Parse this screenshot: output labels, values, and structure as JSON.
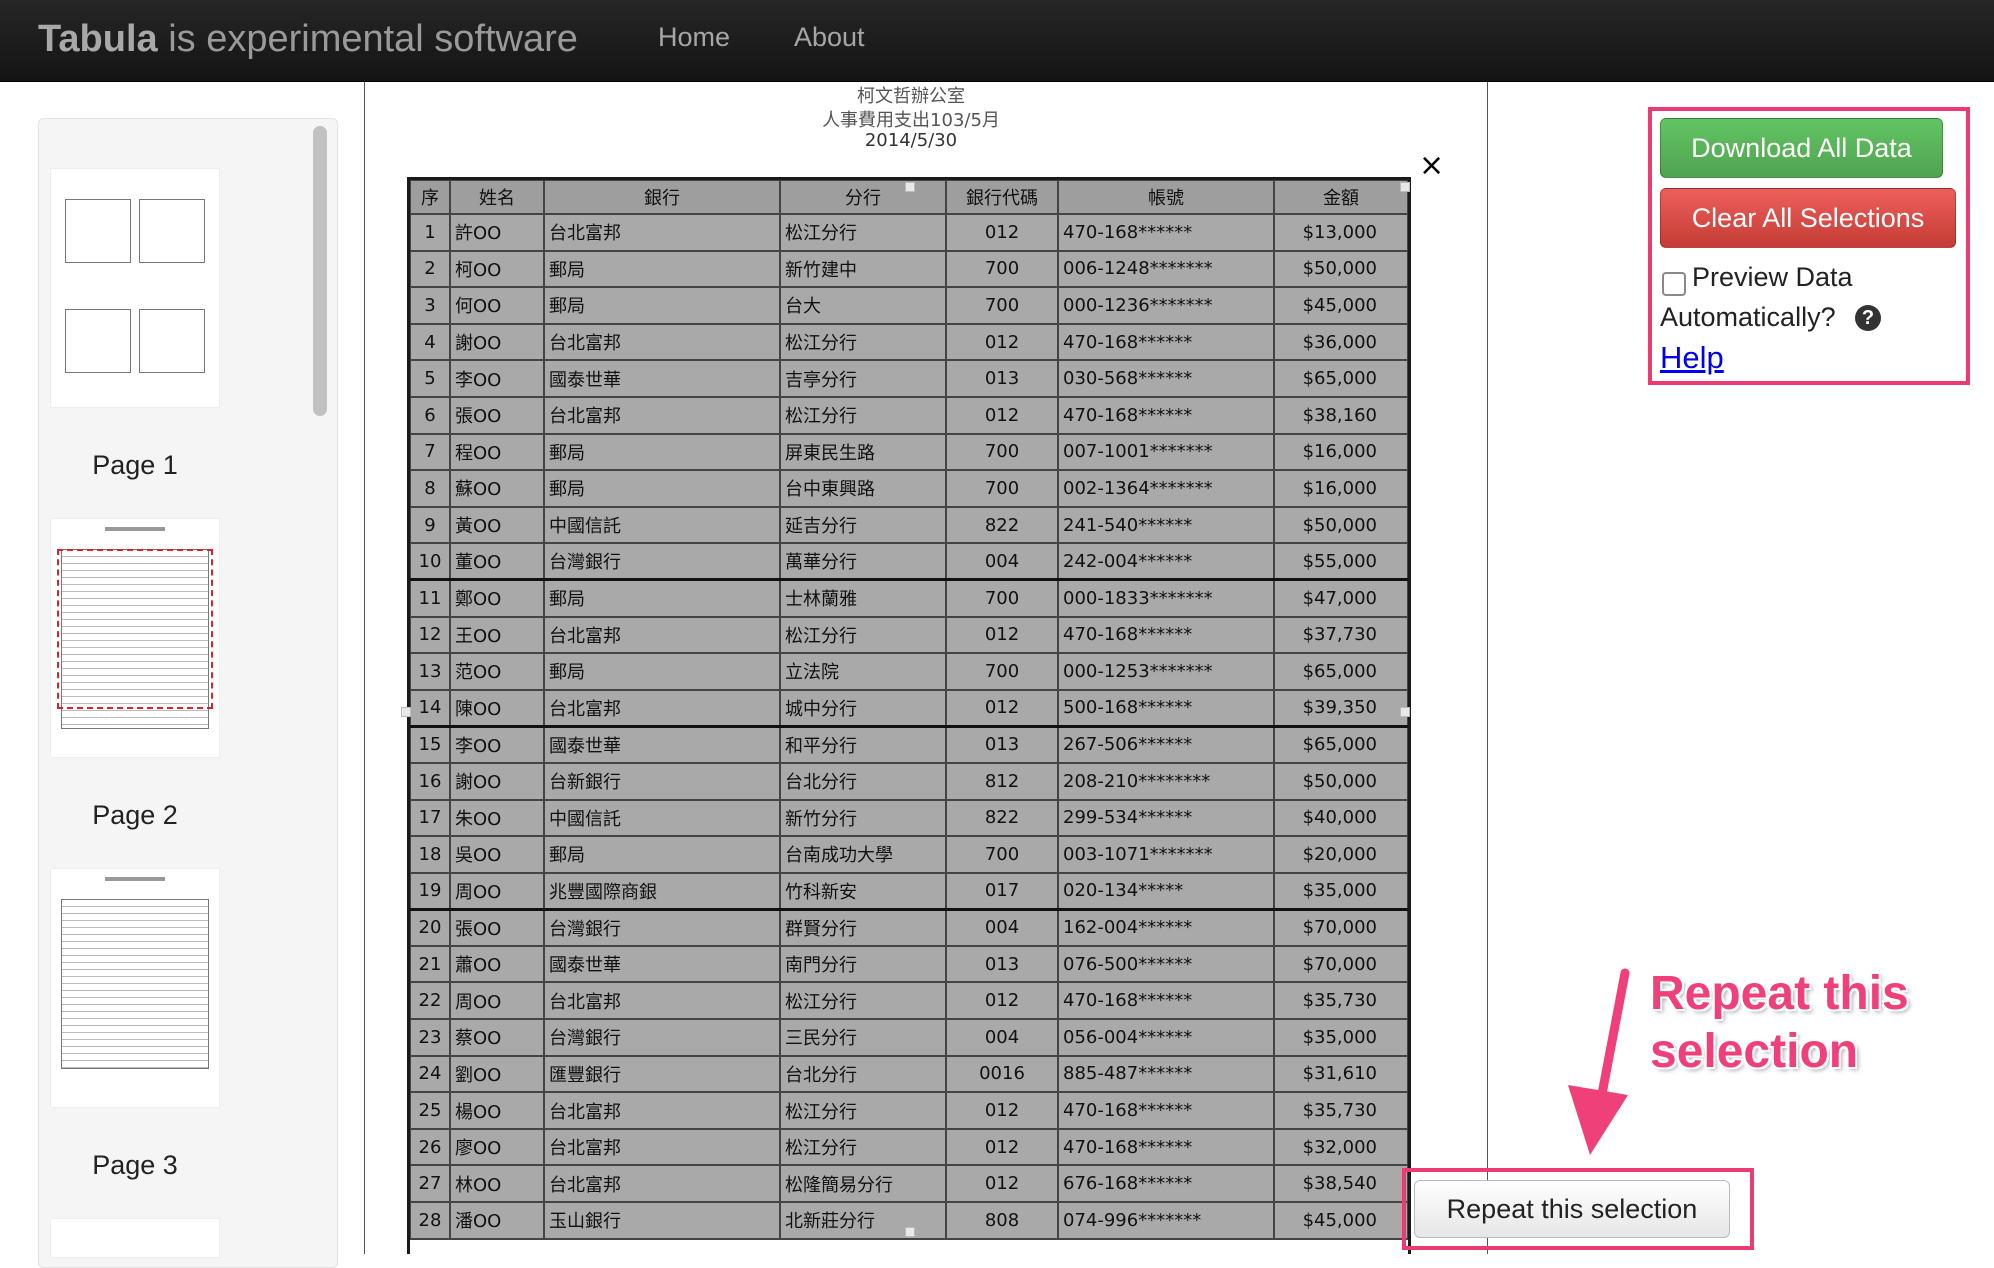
{
  "navbar": {
    "brand_bold": "Tabula",
    "brand_rest": " is experimental software",
    "links": [
      "Home",
      "About"
    ]
  },
  "thumbnails": [
    {
      "label": "Page 1"
    },
    {
      "label": "Page 2"
    },
    {
      "label": "Page 3"
    }
  ],
  "document": {
    "header_lines": [
      "柯文哲辦公室",
      "人事費用支出103/5月",
      "2014/5/30"
    ],
    "columns": [
      "序",
      "姓名",
      "銀行",
      "分行",
      "銀行代碼",
      "帳號",
      "金額"
    ],
    "rows": [
      [
        "1",
        "許OO",
        "台北富邦",
        "松江分行",
        "012",
        "470-168******",
        "$13,000"
      ],
      [
        "2",
        "柯OO",
        "郵局",
        "新竹建中",
        "700",
        "006-1248*******",
        "$50,000"
      ],
      [
        "3",
        "何OO",
        "郵局",
        "台大",
        "700",
        "000-1236*******",
        "$45,000"
      ],
      [
        "4",
        "謝OO",
        "台北富邦",
        "松江分行",
        "012",
        "470-168******",
        "$36,000"
      ],
      [
        "5",
        "李OO",
        "國泰世華",
        "吉亭分行",
        "013",
        "030-568******",
        "$65,000"
      ],
      [
        "6",
        "張OO",
        "台北富邦",
        "松江分行",
        "012",
        "470-168******",
        "$38,160"
      ],
      [
        "7",
        "程OO",
        "郵局",
        "屏東民生路",
        "700",
        "007-1001*******",
        "$16,000"
      ],
      [
        "8",
        "蘇OO",
        "郵局",
        "台中東興路",
        "700",
        "002-1364*******",
        "$16,000"
      ],
      [
        "9",
        "黃OO",
        "中國信託",
        "延吉分行",
        "822",
        "241-540******",
        "$50,000"
      ],
      [
        "10",
        "董OO",
        "台灣銀行",
        "萬華分行",
        "004",
        "242-004******",
        "$55,000"
      ],
      [
        "11",
        "鄭OO",
        "郵局",
        "士林蘭雅",
        "700",
        "000-1833*******",
        "$47,000"
      ],
      [
        "12",
        "王OO",
        "台北富邦",
        "松江分行",
        "012",
        "470-168******",
        "$37,730"
      ],
      [
        "13",
        "范OO",
        "郵局",
        "立法院",
        "700",
        "000-1253*******",
        "$65,000"
      ],
      [
        "14",
        "陳OO",
        "台北富邦",
        "城中分行",
        "012",
        "500-168******",
        "$39,350"
      ],
      [
        "15",
        "李OO",
        "國泰世華",
        "和平分行",
        "013",
        "267-506******",
        "$65,000"
      ],
      [
        "16",
        "謝OO",
        "台新銀行",
        "台北分行",
        "812",
        "208-210********",
        "$50,000"
      ],
      [
        "17",
        "朱OO",
        "中國信託",
        "新竹分行",
        "822",
        "299-534******",
        "$40,000"
      ],
      [
        "18",
        "吳OO",
        "郵局",
        "台南成功大學",
        "700",
        "003-1071*******",
        "$20,000"
      ],
      [
        "19",
        "周OO",
        "兆豐國際商銀",
        "竹科新安",
        "017",
        "020-134*****",
        "$35,000"
      ],
      [
        "20",
        "張OO",
        "台灣銀行",
        "群賢分行",
        "004",
        "162-004******",
        "$70,000"
      ],
      [
        "21",
        "蕭OO",
        "國泰世華",
        "南門分行",
        "013",
        "076-500******",
        "$70,000"
      ],
      [
        "22",
        "周OO",
        "台北富邦",
        "松江分行",
        "012",
        "470-168******",
        "$35,730"
      ],
      [
        "23",
        "蔡OO",
        "台灣銀行",
        "三民分行",
        "004",
        "056-004******",
        "$35,000"
      ],
      [
        "24",
        "劉OO",
        "匯豐銀行",
        "台北分行",
        "0016",
        "885-487******",
        "$31,610"
      ],
      [
        "25",
        "楊OO",
        "台北富邦",
        "松江分行",
        "012",
        "470-168******",
        "$35,730"
      ],
      [
        "26",
        "廖OO",
        "台北富邦",
        "松江分行",
        "012",
        "470-168******",
        "$32,000"
      ],
      [
        "27",
        "林OO",
        "台北富邦",
        "松隆簡易分行",
        "012",
        "676-168******",
        "$38,540"
      ],
      [
        "28",
        "潘OO",
        "玉山銀行",
        "北新莊分行",
        "808",
        "074-996*******",
        "$45,000"
      ]
    ],
    "close_symbol": "×"
  },
  "controls": {
    "download_label": "Download All Data",
    "clear_label": "Clear All Selections",
    "preview_label_1": "Preview Data",
    "preview_label_2": "Automatically?",
    "help_icon_glyph": "?",
    "help_label": "Help",
    "preview_checked": false
  },
  "annotation": {
    "line1": "Repeat this",
    "line2": "selection"
  },
  "repeat_button": {
    "label": "Repeat this selection"
  },
  "colors": {
    "highlight_pink": "#ec3a73",
    "download_green": "#51a351",
    "clear_red": "#c43c35",
    "selection_dashed": "#d9232a"
  },
  "icons": [
    "question-circle-icon",
    "close-icon",
    "arrow-down-icon"
  ]
}
